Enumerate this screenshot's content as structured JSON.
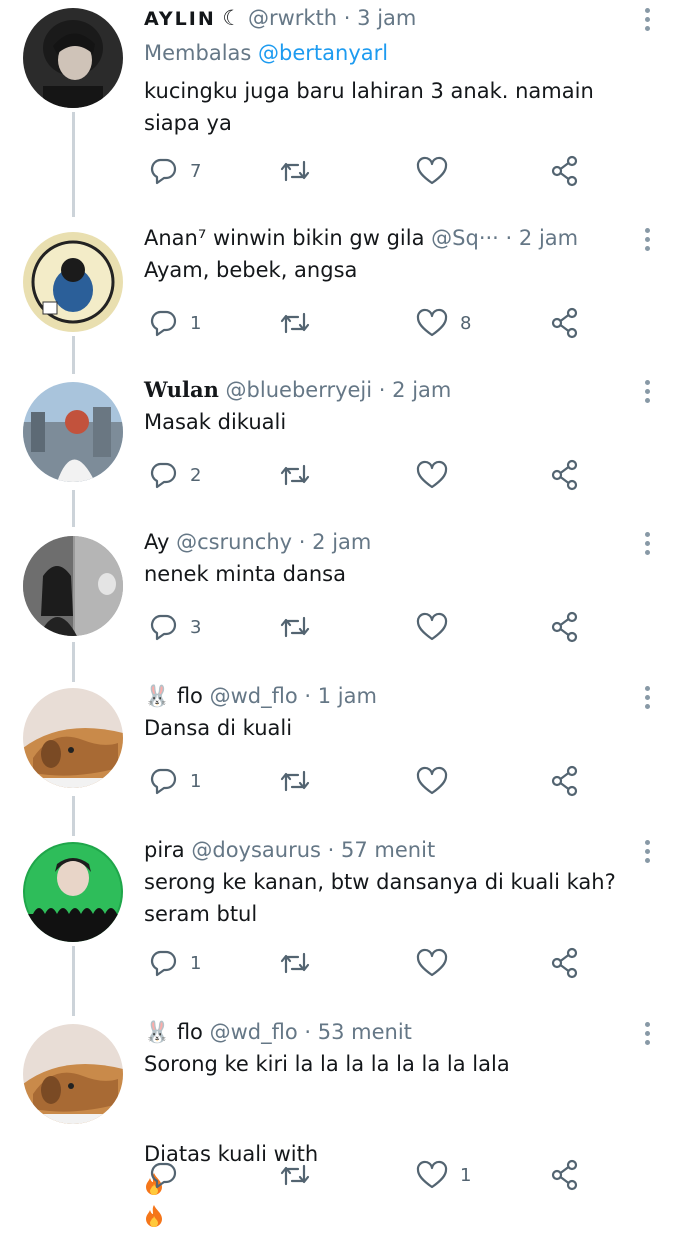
{
  "tweets": [
    {
      "name": "AYLIN",
      "name_suffix": "☾",
      "handle": "@rwrkth",
      "sep": "·",
      "time": "3 jam",
      "replying_prefix": "Membalas",
      "replying_to": "@bertanyarl",
      "text": "kucingku juga baru lahiran 3 anak. namain siapa ya",
      "replies": "7",
      "retweets": "",
      "likes": ""
    },
    {
      "name": "Anan⁷ winwin bikin gw gila",
      "handle": "@Sq···",
      "sep": "·",
      "time": "2 jam",
      "text": "Ayam, bebek, angsa",
      "replies": "1",
      "retweets": "",
      "likes": "8"
    },
    {
      "name": "Wulan",
      "handle": "@blueberryeji",
      "sep": "·",
      "time": "2 jam",
      "text": "Masak dikuali",
      "replies": "2",
      "retweets": "",
      "likes": ""
    },
    {
      "name": "Ay",
      "handle": "@csrunchy",
      "sep": "·",
      "time": "2 jam",
      "text": "nenek minta dansa",
      "replies": "3",
      "retweets": "",
      "likes": ""
    },
    {
      "name": "🐰 flo",
      "handle": "@wd_flo",
      "sep": "·",
      "time": "1 jam",
      "text": "Dansa di kuali",
      "replies": "1",
      "retweets": "",
      "likes": ""
    },
    {
      "name": "pira",
      "handle": "@doysaurus",
      "sep": "·",
      "time": "57 menit",
      "text": "serong ke kanan, btw dansanya di kuali kah? seram btul",
      "replies": "1",
      "retweets": "",
      "likes": ""
    },
    {
      "name": "🐰 flo",
      "handle": "@wd_flo",
      "sep": "·",
      "time": "53 menit",
      "text": "Sorong ke kiri la la la la la la la lala",
      "text2": "Diatas kuali with",
      "replies": "",
      "retweets": "",
      "likes": "1"
    }
  ],
  "colors": {
    "accent": "#1d9bf0",
    "icon": "#536471",
    "thread_line": "#ccd3d9"
  },
  "icons": {
    "reply": "reply-icon",
    "retweet": "retweet-icon",
    "like": "heart-icon",
    "share": "share-icon",
    "more": "more-icon",
    "fire": "fire-emoji"
  }
}
